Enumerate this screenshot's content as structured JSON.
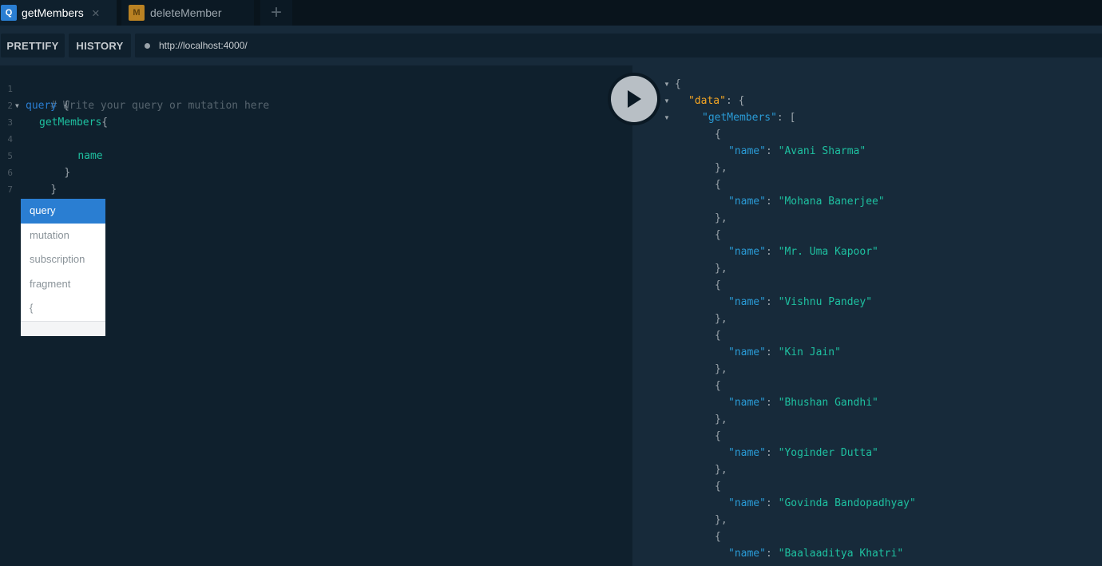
{
  "tabs": [
    {
      "badge": "Q",
      "label": "getMembers",
      "close": "×"
    },
    {
      "badge": "M",
      "label": "deleteMember"
    }
  ],
  "tab_add": "+",
  "toolbar": {
    "prettify": "PRETTIFY",
    "history": "HISTORY",
    "endpoint": "http://localhost:4000/"
  },
  "editor": {
    "line_numbers": [
      "1",
      "2",
      "3",
      "4",
      "5",
      "6",
      "7"
    ],
    "comment": "# Write your query or mutation here",
    "keyword": "query",
    "open_brace": "{",
    "field": "getMembers",
    "field_brace": "{",
    "subfield": "name",
    "close_inner": "}",
    "close_outer": "}"
  },
  "autocomplete": {
    "items": [
      "query",
      "mutation",
      "subscription",
      "fragment",
      "{"
    ],
    "selected": "query"
  },
  "response": {
    "data_key": "\"data\"",
    "list_key": "\"getMembers\"",
    "field_key": "\"name\"",
    "names": [
      "\"Avani Sharma\"",
      "\"Mohana Banerjee\"",
      "\"Mr. Uma Kapoor\"",
      "\"Vishnu Pandey\"",
      "\"Kin Jain\"",
      "\"Bhushan Gandhi\"",
      "\"Yoginder Dutta\"",
      "\"Govinda Bandopadhyay\"",
      "\"Baalaaditya Khatri\""
    ]
  },
  "colors": {
    "query_badge": "#2a7ed2",
    "mutation_badge": "#f5a623",
    "keyword": "#2a7ed2",
    "field": "#1ec0a0",
    "json_key": "#2a9bd6",
    "data_key": "#f5a623",
    "json_string": "#1ec0a0"
  }
}
